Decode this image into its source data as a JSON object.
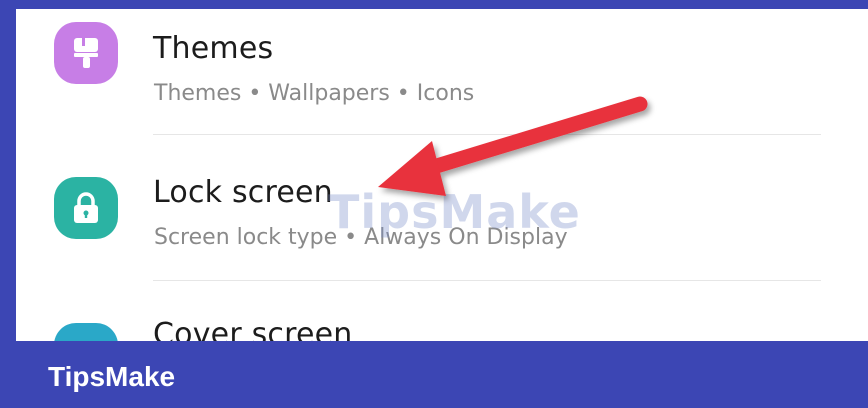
{
  "settings": {
    "items": [
      {
        "title": "Themes",
        "subtitle": "Themes  •  Wallpapers  •  Icons",
        "icon": "brush-icon",
        "icon_color": "#c77ee6"
      },
      {
        "title": "Lock screen",
        "subtitle": "Screen lock type  •  Always On Display",
        "icon": "lock-icon",
        "icon_color": "#2bb3a3"
      },
      {
        "title": "Cover screen",
        "subtitle": "",
        "icon": "cover-screen-icon",
        "icon_color": "#2aa8c8"
      }
    ]
  },
  "watermark": "TipsMake",
  "banner": {
    "text": "TipsMake"
  },
  "colors": {
    "frame": "#3c46b4",
    "arrow": "#e8333c"
  }
}
